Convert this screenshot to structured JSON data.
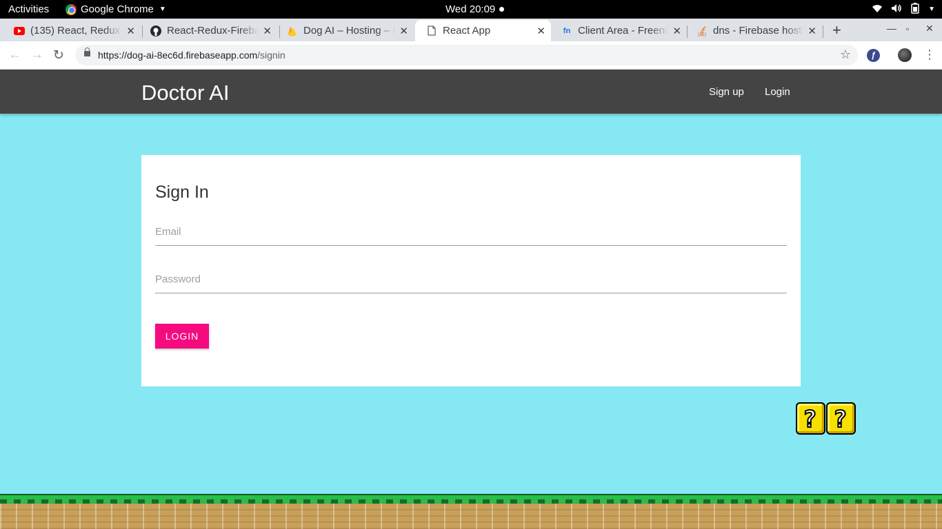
{
  "system_bar": {
    "activities": "Activities",
    "app_name": "Google Chrome",
    "clock": "Wed 20:09"
  },
  "tabs": [
    {
      "title": "(135) React, Redux &",
      "icon": "youtube-icon"
    },
    {
      "title": "React-Redux-Fireba",
      "icon": "github-icon"
    },
    {
      "title": "Dog AI – Hosting – F",
      "icon": "firebase-icon"
    },
    {
      "title": "React App",
      "icon": "page-icon",
      "active": true
    },
    {
      "title": "Client Area - Freeno",
      "icon": "freenom-icon"
    },
    {
      "title": "dns - Firebase hosti",
      "icon": "stackoverflow-icon"
    }
  ],
  "address_bar": {
    "url_host": "https://dog-ai-8ec6d.firebaseapp.com",
    "url_path": "/signin"
  },
  "app": {
    "brand": "Doctor AI",
    "nav": {
      "signup": "Sign up",
      "login": "Login"
    }
  },
  "signin_form": {
    "title": "Sign In",
    "email_placeholder": "Email",
    "password_placeholder": "Password",
    "submit_label": "LOGIN"
  },
  "decorations": {
    "block_glyph": "?"
  },
  "colors": {
    "page_background": "#86e8f3",
    "navbar": "#444444",
    "button_accent": "#f50a80"
  }
}
